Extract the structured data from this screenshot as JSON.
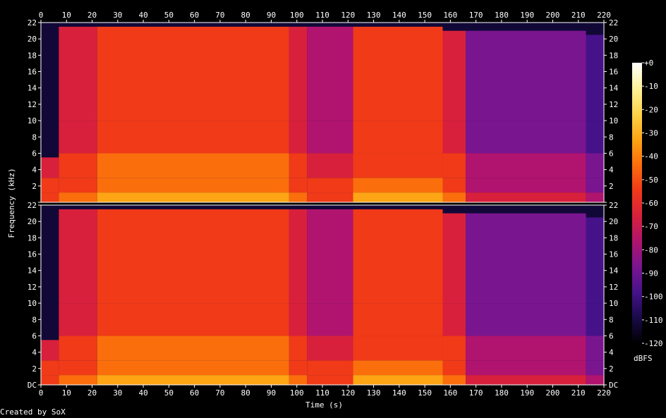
{
  "chart_data": {
    "type": "heatmap",
    "title": "",
    "xlabel": "Time (s)",
    "ylabel": "Frequency (kHz)",
    "credit": "Created by SoX",
    "xlim": [
      0,
      220
    ],
    "ylim": [
      0,
      22
    ],
    "x_ticks": [
      0,
      10,
      20,
      30,
      40,
      50,
      60,
      70,
      80,
      90,
      100,
      110,
      120,
      130,
      140,
      150,
      160,
      170,
      180,
      190,
      200,
      210,
      220
    ],
    "y_ticks": [
      {
        "value": 0,
        "label": "DC"
      },
      {
        "value": 2,
        "label": "2"
      },
      {
        "value": 4,
        "label": "4"
      },
      {
        "value": 6,
        "label": "6"
      },
      {
        "value": 8,
        "label": "8"
      },
      {
        "value": 10,
        "label": "10"
      },
      {
        "value": 12,
        "label": "12"
      },
      {
        "value": 14,
        "label": "14"
      },
      {
        "value": 16,
        "label": "16"
      },
      {
        "value": 18,
        "label": "18"
      },
      {
        "value": 20,
        "label": "20"
      },
      {
        "value": 22,
        "label": "22"
      }
    ],
    "channels": 2,
    "colorbar": {
      "unit": "dBFS",
      "range": [
        -120,
        0
      ],
      "ticks": [
        "+0",
        "-10",
        "-20",
        "-30",
        "-40",
        "-50",
        "-60",
        "-70",
        "-80",
        "-90",
        "-100",
        "-110",
        "-120"
      ],
      "colors": [
        "#000000",
        "#1a0a4a",
        "#46128a",
        "#7a1590",
        "#b0146e",
        "#d8203c",
        "#f03a18",
        "#fb6e0c",
        "#fda514",
        "#fdd34a",
        "#fff29c",
        "#ffffff"
      ]
    },
    "segments": [
      {
        "start": 0,
        "end": 7,
        "level_db": -72,
        "cutoff_khz": 5.5
      },
      {
        "start": 7,
        "end": 22,
        "level_db": -66,
        "cutoff_khz": 21.5
      },
      {
        "start": 22,
        "end": 97,
        "level_db": -54,
        "cutoff_khz": 21.5
      },
      {
        "start": 97,
        "end": 104,
        "level_db": -62,
        "cutoff_khz": 21.5
      },
      {
        "start": 104,
        "end": 122,
        "level_db": -72,
        "cutoff_khz": 21.5
      },
      {
        "start": 122,
        "end": 157,
        "level_db": -56,
        "cutoff_khz": 21.5
      },
      {
        "start": 157,
        "end": 166,
        "level_db": -64,
        "cutoff_khz": 21
      },
      {
        "start": 166,
        "end": 213,
        "level_db": -84,
        "cutoff_khz": 21
      },
      {
        "start": 213,
        "end": 220,
        "level_db": -98,
        "cutoff_khz": 20.5
      }
    ]
  }
}
